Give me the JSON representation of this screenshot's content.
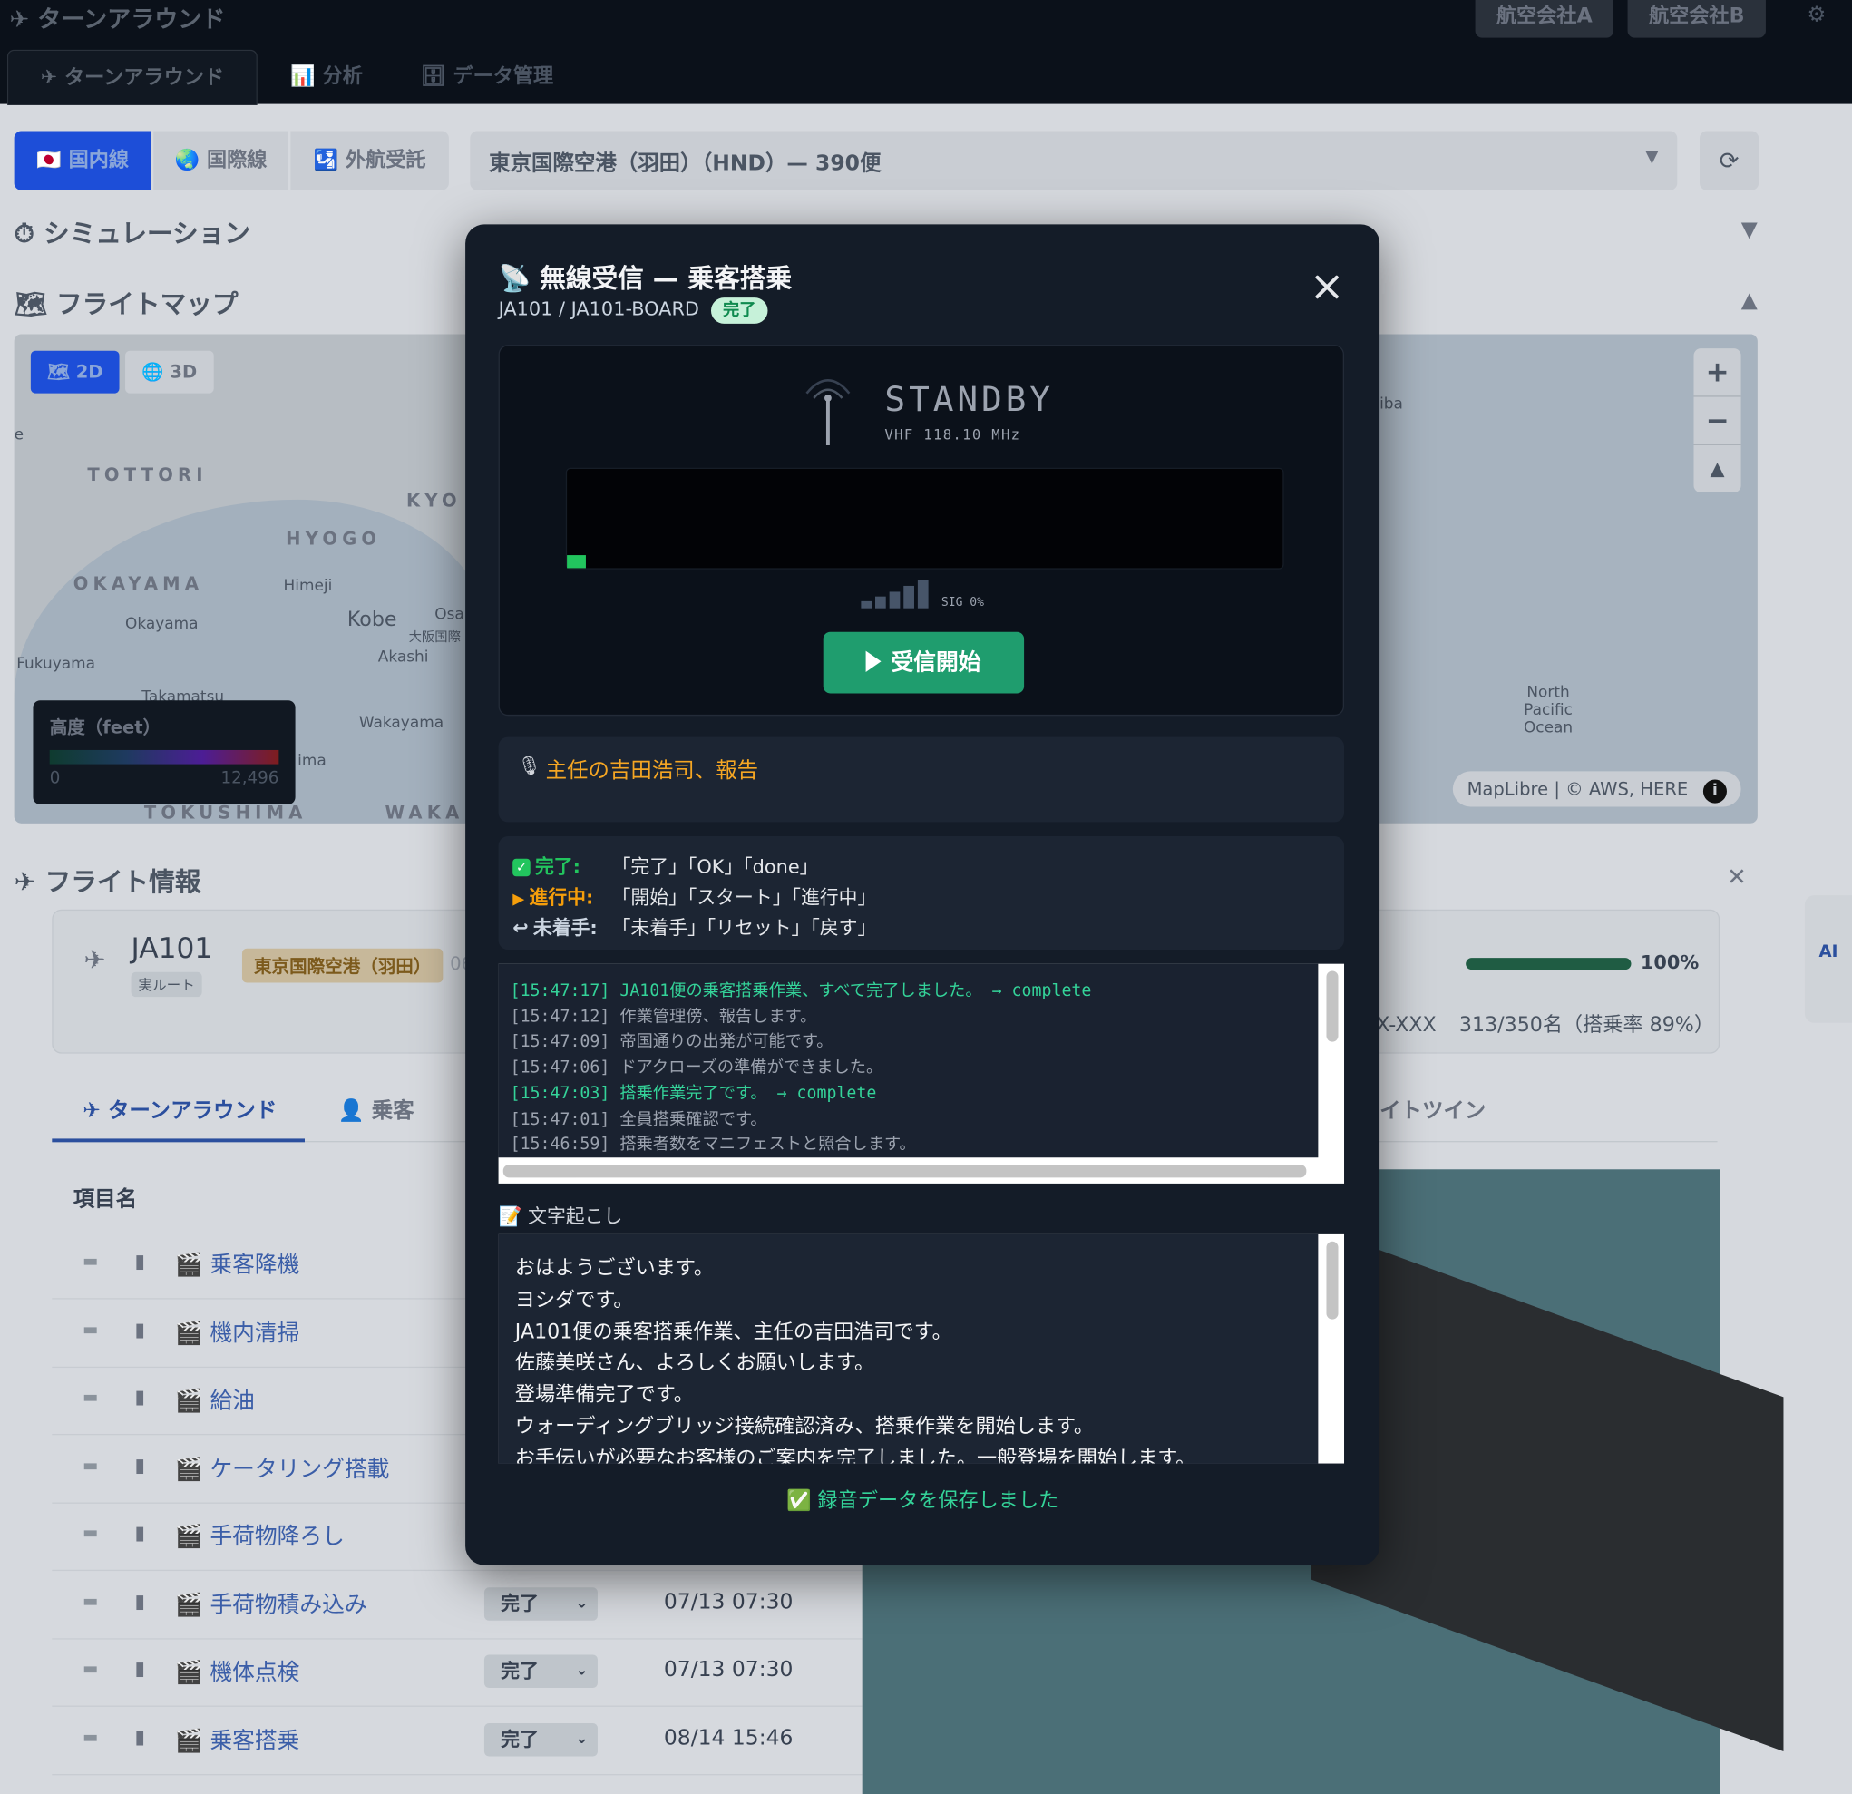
{
  "app": {
    "title": "✈ ターンアラウンド",
    "airlines": [
      "航空会社A",
      "航空会社B"
    ],
    "settings_icon": "⚙",
    "nav_tabs": [
      {
        "label": "✈ ターンアラウンド",
        "active": true
      },
      {
        "label": "📊 分析",
        "active": false
      },
      {
        "label": "🗄 データ管理",
        "active": false
      }
    ]
  },
  "segments": [
    {
      "label": "🇯🇵 国内線",
      "active": true
    },
    {
      "label": "🌏 国際線",
      "active": false
    },
    {
      "label": "🛂 外航受託",
      "active": false
    }
  ],
  "airport_select": {
    "value": "東京国際空港（羽田）（HND）— 390便",
    "caret": "▼"
  },
  "refresh_icon": "⟳",
  "sections": {
    "simulation": "⏱ シミュレーション",
    "simulation_arrow": "▼",
    "flight_map": "🗺 フライトマップ",
    "flight_map_arrow": "▲",
    "flight_info": "✈ フライト情報"
  },
  "map": {
    "mode_2d": "🗺 2D",
    "mode_3d": "🌐 3D",
    "regions": [
      "TOTTORI",
      "HYOGO",
      "OKAYAMA",
      "TOKUSHIMA",
      "KYO",
      "WAKA"
    ],
    "cities": [
      "Himeji",
      "Okayama",
      "Kobe",
      "Fukuyama",
      "Akashi",
      "Takamatsu",
      "Wakayama",
      "大阪国際",
      "Osa",
      "iba",
      "ima",
      "e"
    ],
    "ocean": [
      "North",
      "Pacific",
      "Ocean"
    ],
    "zoom_in": "+",
    "zoom_out": "−",
    "compass": "▲",
    "attribution": "MapLibre | © AWS, HERE",
    "info_icon": "i",
    "legend": {
      "title": "高度（feet）",
      "min": "0",
      "max": "12,496"
    }
  },
  "flight": {
    "number": "JA101",
    "route_type": "実ルート",
    "airport": "東京国際空港（羽田）",
    "airport_trail": "06",
    "progress_pct": "100%",
    "progress": 1.0,
    "reg": "X-XXX",
    "pax": "313/350名（搭乗率 89%）"
  },
  "sub_tabs": [
    {
      "label": "✈ ターンアラウンド",
      "active": true
    },
    {
      "label": "👤 乗客",
      "active": false
    },
    {
      "label": "イトツイン",
      "active": false
    }
  ],
  "table": {
    "header": "項目名",
    "rows": [
      {
        "name": "乗客降機",
        "status": "",
        "time": ""
      },
      {
        "name": "機内清掃",
        "status": "",
        "time": ""
      },
      {
        "name": "給油",
        "status": "",
        "time": ""
      },
      {
        "name": "ケータリング搭載",
        "status": "",
        "time": ""
      },
      {
        "name": "手荷物降ろし",
        "status": "",
        "time": ""
      },
      {
        "name": "手荷物積み込み",
        "status": "完了",
        "time": "07/13 07:30"
      },
      {
        "name": "機体点検",
        "status": "完了",
        "time": "07/13 07:30"
      },
      {
        "name": "乗客搭乗",
        "status": "完了",
        "time": "08/14 15:46"
      }
    ],
    "row_icon": "🎬",
    "status_caret": "⌄"
  },
  "ai_tab": "AI",
  "close_bg": "✕",
  "modal": {
    "title": "📡 無線受信 — 乗客搭乗",
    "subtitle": "JA101 / JA101-BOARD",
    "badge": "完了",
    "radio": {
      "status": "STANDBY",
      "frequency": "VHF 118.10 MHz",
      "signal_text": "SIG 0%",
      "signal_level": 0,
      "button": "受信開始"
    },
    "report": {
      "icon": "🎙",
      "text": "主任の吉田浩司、報告"
    },
    "keywords": [
      {
        "icon": "✓",
        "label": "完了:",
        "values": "「完了」「OK」「done」",
        "color": "#22c55e"
      },
      {
        "icon": "▶",
        "label": "進行中:",
        "values": "「開始」「スタート」「進行中」",
        "color": "#f59e0b"
      },
      {
        "icon": "↩",
        "label": "未着手:",
        "values": "「未着手」「リセット」「戻す」",
        "color": "#cbd5e1"
      }
    ],
    "log": [
      {
        "text": "[15:47:17] JA101便の乗客搭乗作業、すべて完了しました。 → complete",
        "ok": true
      },
      {
        "text": "[15:47:12] 作業管理傍、報告します。",
        "ok": false
      },
      {
        "text": "[15:47:09] 帝国通りの出発が可能です。",
        "ok": false
      },
      {
        "text": "[15:47:06] ドアクローズの準備ができました。",
        "ok": false
      },
      {
        "text": "[15:47:03] 搭乗作業完了です。 → complete",
        "ok": true
      },
      {
        "text": "[15:47:01] 全員搭乗確認です。",
        "ok": false
      },
      {
        "text": "[15:46:59] 搭乗者数をマニフェストと照合します。",
        "ok": false
      }
    ],
    "transcript_label": "📝 文字起こし",
    "transcript": [
      "おはようございます。",
      "ヨシダです。",
      "JA101便の乗客搭乗作業、主任の吉田浩司です。",
      "佐藤美咲さん、よろしくお願いします。",
      "登場準備完了です。",
      "ウォーディングブリッジ接続確認済み、搭乗作業を開始します。",
      "お手伝いが必要なお客様のご案内を完了しました。一般登場を開始します。"
    ],
    "saved": "✅ 録音データを保存しました"
  }
}
